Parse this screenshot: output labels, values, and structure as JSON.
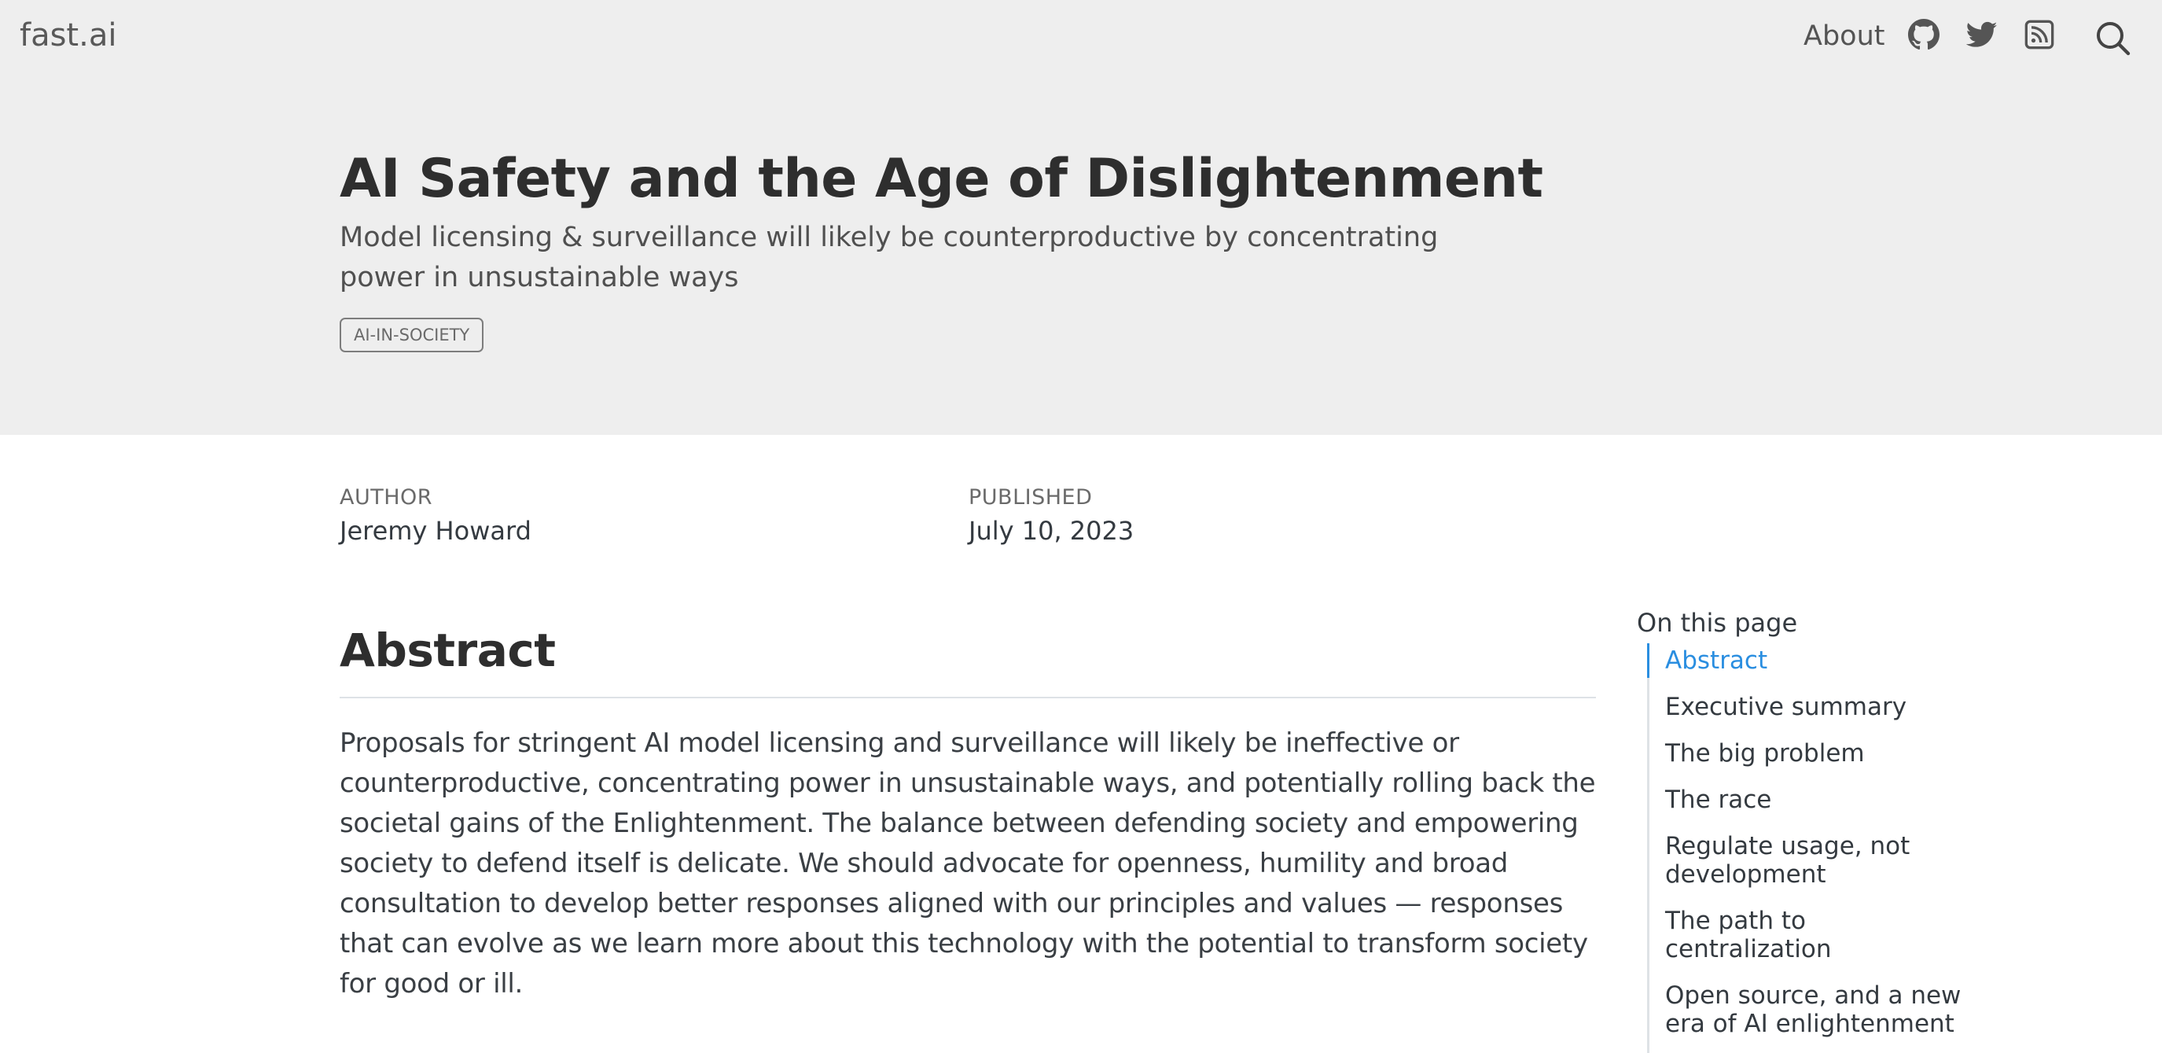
{
  "header": {
    "brand": "fast.ai",
    "nav_about": "About",
    "icons": [
      "github-icon",
      "twitter-icon",
      "rss-icon",
      "search-icon"
    ]
  },
  "banner": {
    "title": "AI Safety and the Age of Dislightenment",
    "subtitle": "Model licensing & surveillance will likely be counterproductive by concentrating power in unsustainable ways",
    "category": "AI-IN-SOCIETY"
  },
  "meta": {
    "author_label": "AUTHOR",
    "author": "Jeremy Howard",
    "published_label": "PUBLISHED",
    "published": "July 10, 2023"
  },
  "article": {
    "heading": "Abstract",
    "abstract": "Proposals for stringent AI model licensing and surveillance will likely be ineffective or counterproductive, concentrating power in unsustainable ways, and potentially rolling back the societal gains of the Enlightenment. The balance between defending society and empowering society to defend itself is delicate. We should advocate for openness, humility and broad consultation to develop better responses aligned with our principles and values — responses that can evolve as we learn more about this technology with the potential to transform society for good or ill."
  },
  "toc": {
    "title": "On this page",
    "items": [
      "Abstract",
      "Executive summary",
      "The big problem",
      "The race",
      "Regulate usage, not development",
      "The path to centralization",
      "Open source, and a new era of AI enlightenment"
    ],
    "active_index": 0
  },
  "colors": {
    "banner_bg": "#eeeeee",
    "accent": "#2a8ee0",
    "text": "#343a40"
  }
}
